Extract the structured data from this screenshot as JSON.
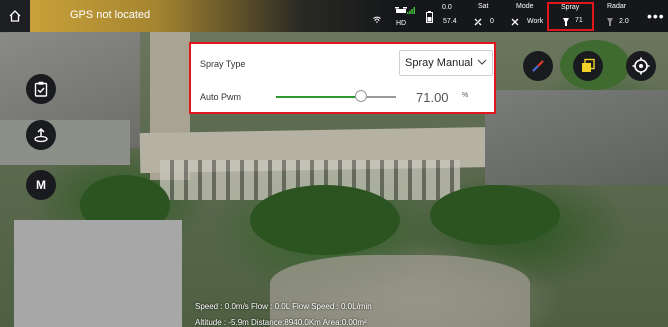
{
  "topbar": {
    "gps_status": "GPS not located",
    "signal": {
      "label": "HD"
    },
    "battery": {
      "top": "0.0",
      "bottom": "57.4"
    },
    "sat": {
      "label": "Sat",
      "value": "0"
    },
    "mode": {
      "label": "Mode",
      "value": "Work"
    },
    "spray": {
      "label": "Spray",
      "value": "71"
    },
    "radar": {
      "label": "Radar",
      "value": "2.0"
    },
    "more": "•••"
  },
  "left_tools": [
    {
      "name": "checklist-icon"
    },
    {
      "name": "takeoff-point-icon"
    },
    {
      "name": "mode-m-button",
      "label": "M"
    }
  ],
  "right_tools": [
    {
      "name": "compass-icon"
    },
    {
      "name": "layers-icon"
    },
    {
      "name": "locate-target-icon"
    }
  ],
  "panel": {
    "spray_type_label": "Spray Type",
    "spray_type_value": "Spray Manual",
    "auto_pwm_label": "Auto Pwm",
    "auto_pwm_value": "71.00",
    "auto_pwm_unit": "%",
    "auto_pwm_level": 0.71
  },
  "telemetry": {
    "line1": "Speed : 0.0m/s   Flow : 0.0L   Flow Speed : 0.0L/min",
    "line2": "Altitude : -5.9m   Distance:8940.0Km   Area:0.00m²"
  },
  "colors": {
    "highlight": "#e0181e",
    "slider_fill": "#2e9a2e",
    "gps_warning": "#c9a13a",
    "topbar": "#15171a"
  }
}
